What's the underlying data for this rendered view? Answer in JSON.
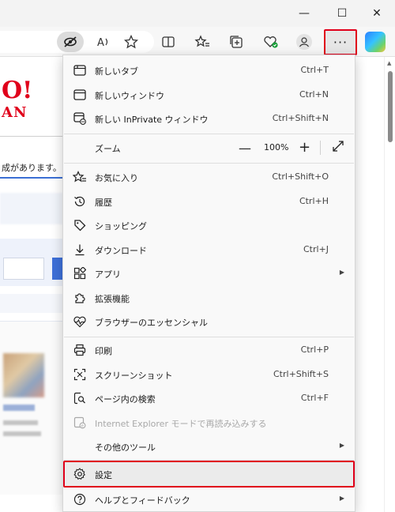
{
  "window": {
    "minimize_glyph": "—",
    "maximize_glyph": "☐",
    "close_glyph": "✕"
  },
  "toolbar": {
    "more_glyph": "···",
    "icons": [
      "tracking-prevention-icon",
      "read-aloud-icon",
      "favorite-star-icon",
      "split-screen-icon",
      "favorites-icon",
      "collections-icon",
      "browser-essentials-icon",
      "profile-icon",
      "copilot-icon"
    ]
  },
  "page": {
    "logo": "O!",
    "logo_sub": "AN",
    "notice": "成があります。"
  },
  "menu": {
    "new_tab": {
      "label": "新しいタブ",
      "shortcut": "Ctrl+T"
    },
    "new_window": {
      "label": "新しいウィンドウ",
      "shortcut": "Ctrl+N"
    },
    "new_inprivate": {
      "label": "新しい InPrivate ウィンドウ",
      "shortcut": "Ctrl+Shift+N"
    },
    "zoom": {
      "label": "ズーム",
      "value": "100%",
      "minus": "—",
      "plus": "+"
    },
    "favorites": {
      "label": "お気に入り",
      "shortcut": "Ctrl+Shift+O"
    },
    "history": {
      "label": "履歴",
      "shortcut": "Ctrl+H"
    },
    "shopping": {
      "label": "ショッピング"
    },
    "downloads": {
      "label": "ダウンロード",
      "shortcut": "Ctrl+J"
    },
    "apps": {
      "label": "アプリ"
    },
    "extensions": {
      "label": "拡張機能"
    },
    "essentials": {
      "label": "ブラウザーのエッセンシャル"
    },
    "print": {
      "label": "印刷",
      "shortcut": "Ctrl+P"
    },
    "screenshot": {
      "label": "スクリーンショット",
      "shortcut": "Ctrl+Shift+S"
    },
    "find": {
      "label": "ページ内の検索",
      "shortcut": "Ctrl+F"
    },
    "ie_mode": {
      "label": "Internet Explorer モードで再読み込みする"
    },
    "more_tools": {
      "label": "その他のツール"
    },
    "settings": {
      "label": "設定"
    },
    "help": {
      "label": "ヘルプとフィードバック"
    }
  },
  "colors": {
    "highlight_red": "#e0001b",
    "menu_bg": "#f9f9f9",
    "yahoo_red": "#e0001b"
  }
}
